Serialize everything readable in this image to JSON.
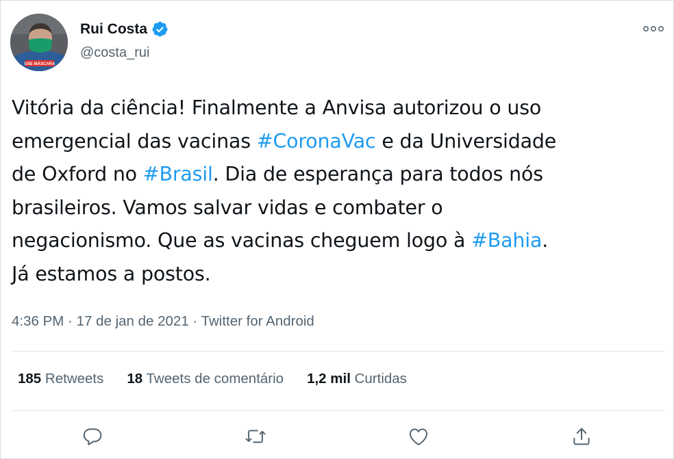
{
  "author": {
    "name": "Rui Costa",
    "handle": "@costa_rui",
    "avatar_badge": "USE MÁSCARA",
    "verified_color": "#1d9bf0"
  },
  "tweet": {
    "lines": [
      [
        {
          "t": "Vitória da ciência! Finalmente a Anvisa autorizou o uso"
        }
      ],
      [
        {
          "t": "emergencial das vacinas "
        },
        {
          "t": "#CoronaVac",
          "tag": true
        },
        {
          "t": " e da Universidade"
        }
      ],
      [
        {
          "t": "de Oxford no "
        },
        {
          "t": "#Brasil",
          "tag": true
        },
        {
          "t": ". Dia de esperança para todos nós"
        }
      ],
      [
        {
          "t": "brasileiros. Vamos salvar vidas e combater o"
        }
      ],
      [
        {
          "t": "negacionismo. Que as vacinas cheguem logo à "
        },
        {
          "t": "#Bahia",
          "tag": true
        },
        {
          "t": "."
        }
      ],
      [
        {
          "t": "Já estamos a postos."
        }
      ]
    ],
    "hashtag_color": "#1d9bf0"
  },
  "meta": {
    "time": "4:36 PM",
    "separator": " · ",
    "date": "17 de jan de 2021",
    "source": "Twitter for Android"
  },
  "stats": [
    {
      "count": "185",
      "label": "Retweets"
    },
    {
      "count": "18",
      "label": "Tweets de comentário"
    },
    {
      "count": "1,2 mil",
      "label": "Curtidas"
    }
  ],
  "actions": [
    {
      "icon": "reply-icon"
    },
    {
      "icon": "retweet-icon"
    },
    {
      "icon": "like-icon"
    },
    {
      "icon": "share-icon"
    }
  ],
  "more_icon": "more-options-icon"
}
